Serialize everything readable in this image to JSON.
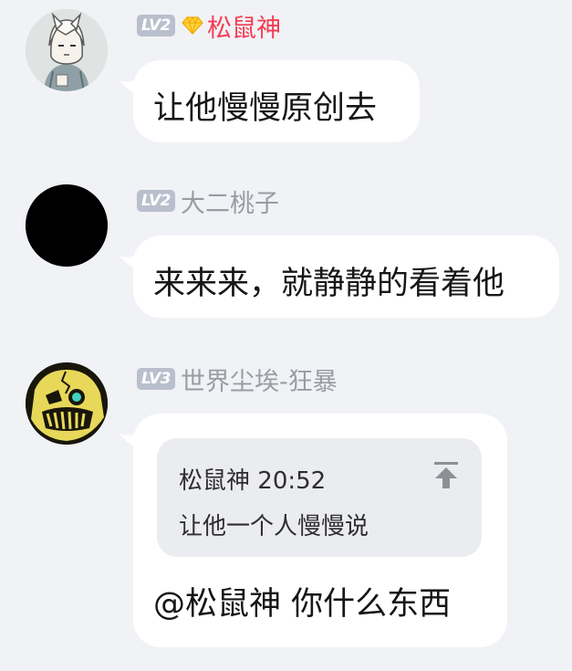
{
  "messages": [
    {
      "avatar": "cartoon-girl-avatar",
      "level": "LV2",
      "vip": true,
      "nickname": "松鼠神",
      "text": "让他慢慢原创去"
    },
    {
      "avatar": "black-circle-avatar",
      "level": "LV2",
      "vip": false,
      "nickname": "大二桃子",
      "text": "来来来，就静静的看着他"
    },
    {
      "avatar": "yellow-monster-avatar",
      "level": "LV3",
      "vip": false,
      "nickname": "世界尘埃-狂暴",
      "quote": {
        "author": "松鼠神",
        "time": "20:52",
        "text": "让他一个人慢慢说"
      },
      "text": "@松鼠神  你什么东西"
    }
  ],
  "colors": {
    "background": "#f1f2f6",
    "bubble": "#ffffff",
    "vip_name": "#f43c52",
    "name": "#9a9ca3",
    "level_badge": "#b9bfcc",
    "quote_bg": "#ebecf0"
  }
}
